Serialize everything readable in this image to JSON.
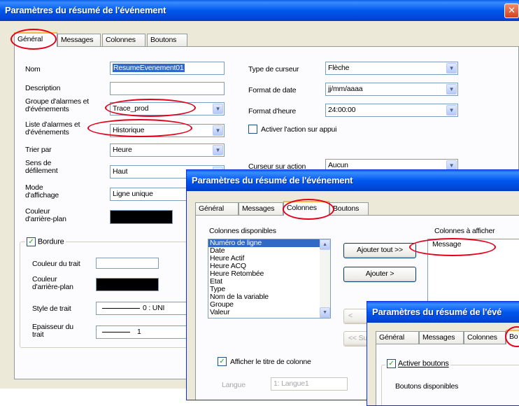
{
  "win1": {
    "title": "Paramètres du résumé de l'événement",
    "close": "✕",
    "tabs": [
      "Général",
      "Messages",
      "Colonnes",
      "Boutons"
    ],
    "fields": {
      "nom_label": "Nom",
      "nom_value": "ResumeEvenement01",
      "description_label": "Description",
      "description_value": "",
      "groupe_label": "Groupe d'alarmes et d'événements",
      "groupe_value": "Trace_prod",
      "liste_label": "Liste d'alarmes et d'événements",
      "liste_value": "Historique",
      "trier_label": "Trier par",
      "trier_value": "Heure",
      "sens_label": "Sens de défilement",
      "sens_value": "Haut",
      "mode_label": "Mode d'affichage",
      "mode_value": "Ligne unique",
      "couleur_ap_label": "Couleur d'arrière-plan",
      "type_curseur_label": "Type de curseur",
      "type_curseur_value": "Flèche",
      "format_date_label": "Format de date",
      "format_date_value": "jj/mm/aaaa",
      "format_heure_label": "Format d'heure",
      "format_heure_value": "24:00:00",
      "activer_action_label": "Activer l'action sur appui",
      "curseur_action_label": "Curseur sur action",
      "curseur_action_value": "Aucun"
    },
    "bordure": {
      "title": "Bordure",
      "checked": "✓",
      "couleur_trait_label": "Couleur du trait",
      "couleur_ap_label": "Couleur d'arrière-plan",
      "style_trait_label": "Style de trait",
      "style_trait_value": "0 : UNI",
      "epaisseur_label": "Epaisseur du trait",
      "epaisseur_value": "1"
    }
  },
  "win2": {
    "title": "Paramètres du résumé de l'événement",
    "tabs": [
      "Général",
      "Messages",
      "Colonnes",
      "Boutons"
    ],
    "dispo_label": "Colonnes disponibles",
    "afficher_label": "Colonnes à afficher",
    "dispo_items": [
      "Numéro de ligne",
      "Date",
      "Heure Actif",
      "Heure ACQ",
      "Heure Retombée",
      "Etat",
      "Type",
      "Nom de la variable",
      "Groupe",
      "Valeur"
    ],
    "afficher_items": [
      "Message"
    ],
    "btn_ajouter_tout": "Ajouter tout >>",
    "btn_ajouter": "Ajouter >",
    "btn_partial_1": "<",
    "btn_partial_2": "<< Su",
    "afficher_titre_label": "Afficher le titre de colonne",
    "checked": "✓",
    "langue_label": "Langue",
    "langue_value": "1: Langue1"
  },
  "win3": {
    "title": "Paramètres du résumé de l'évé",
    "tabs": [
      "Général",
      "Messages",
      "Colonnes",
      "Bo"
    ],
    "activer_boutons_label": "Activer boutons",
    "checked": "✓",
    "boutons_dispo_label": "Boutons disponibles"
  },
  "colors": {
    "title_bar": "#0058ee",
    "highlight": "#e3001b",
    "selection": "#316ac5"
  }
}
